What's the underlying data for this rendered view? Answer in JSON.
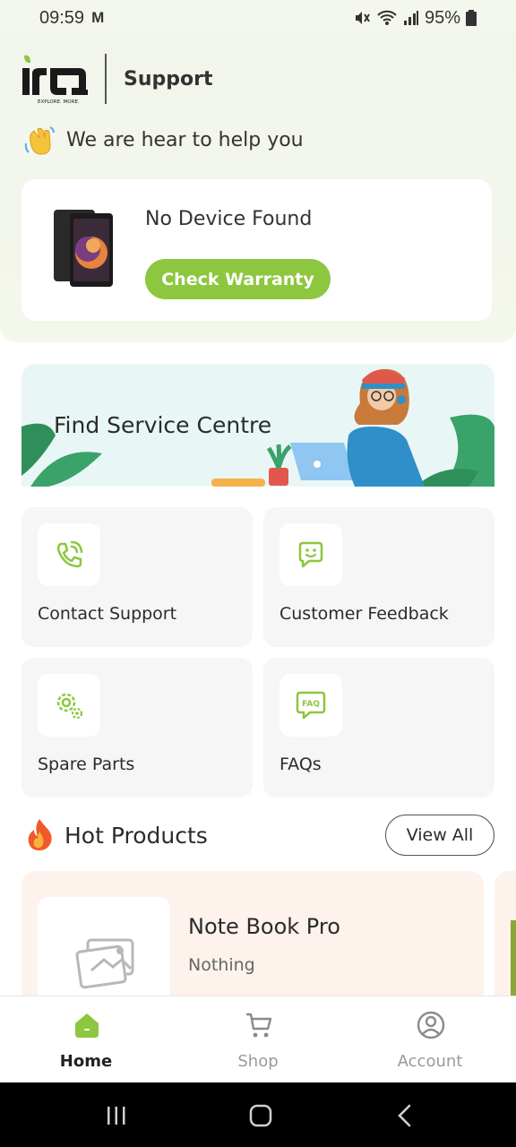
{
  "status_bar": {
    "time": "09:59",
    "mail_icon": "M",
    "battery": "95%"
  },
  "header": {
    "title": "Support",
    "logo_tagline": "EXPLORE. MORE."
  },
  "hero": {
    "text": "We are hear to help you"
  },
  "device_card": {
    "title": "No Device Found",
    "button_label": "Check Warranty"
  },
  "banner": {
    "text": "Find Service Centre"
  },
  "tiles": [
    {
      "label": "Contact Support",
      "icon": "phone-icon"
    },
    {
      "label": "Customer Feedback",
      "icon": "chat-smile-icon"
    },
    {
      "label": "Spare Parts",
      "icon": "gear-icon"
    },
    {
      "label": "FAQs",
      "icon": "faq-icon"
    }
  ],
  "hot_products": {
    "title": "Hot Products",
    "view_all": "View All",
    "items": [
      {
        "name": "Note Book Pro",
        "subtitle": "Nothing"
      }
    ]
  },
  "bottom_nav": {
    "items": [
      {
        "label": "Home"
      },
      {
        "label": "Shop"
      },
      {
        "label": "Account"
      }
    ]
  },
  "colors": {
    "accent": "#8dc63f",
    "panel_bg": "#f2f5ec",
    "banner_bg": "#e9f6f6",
    "product_bg": "#fdf2ec"
  }
}
